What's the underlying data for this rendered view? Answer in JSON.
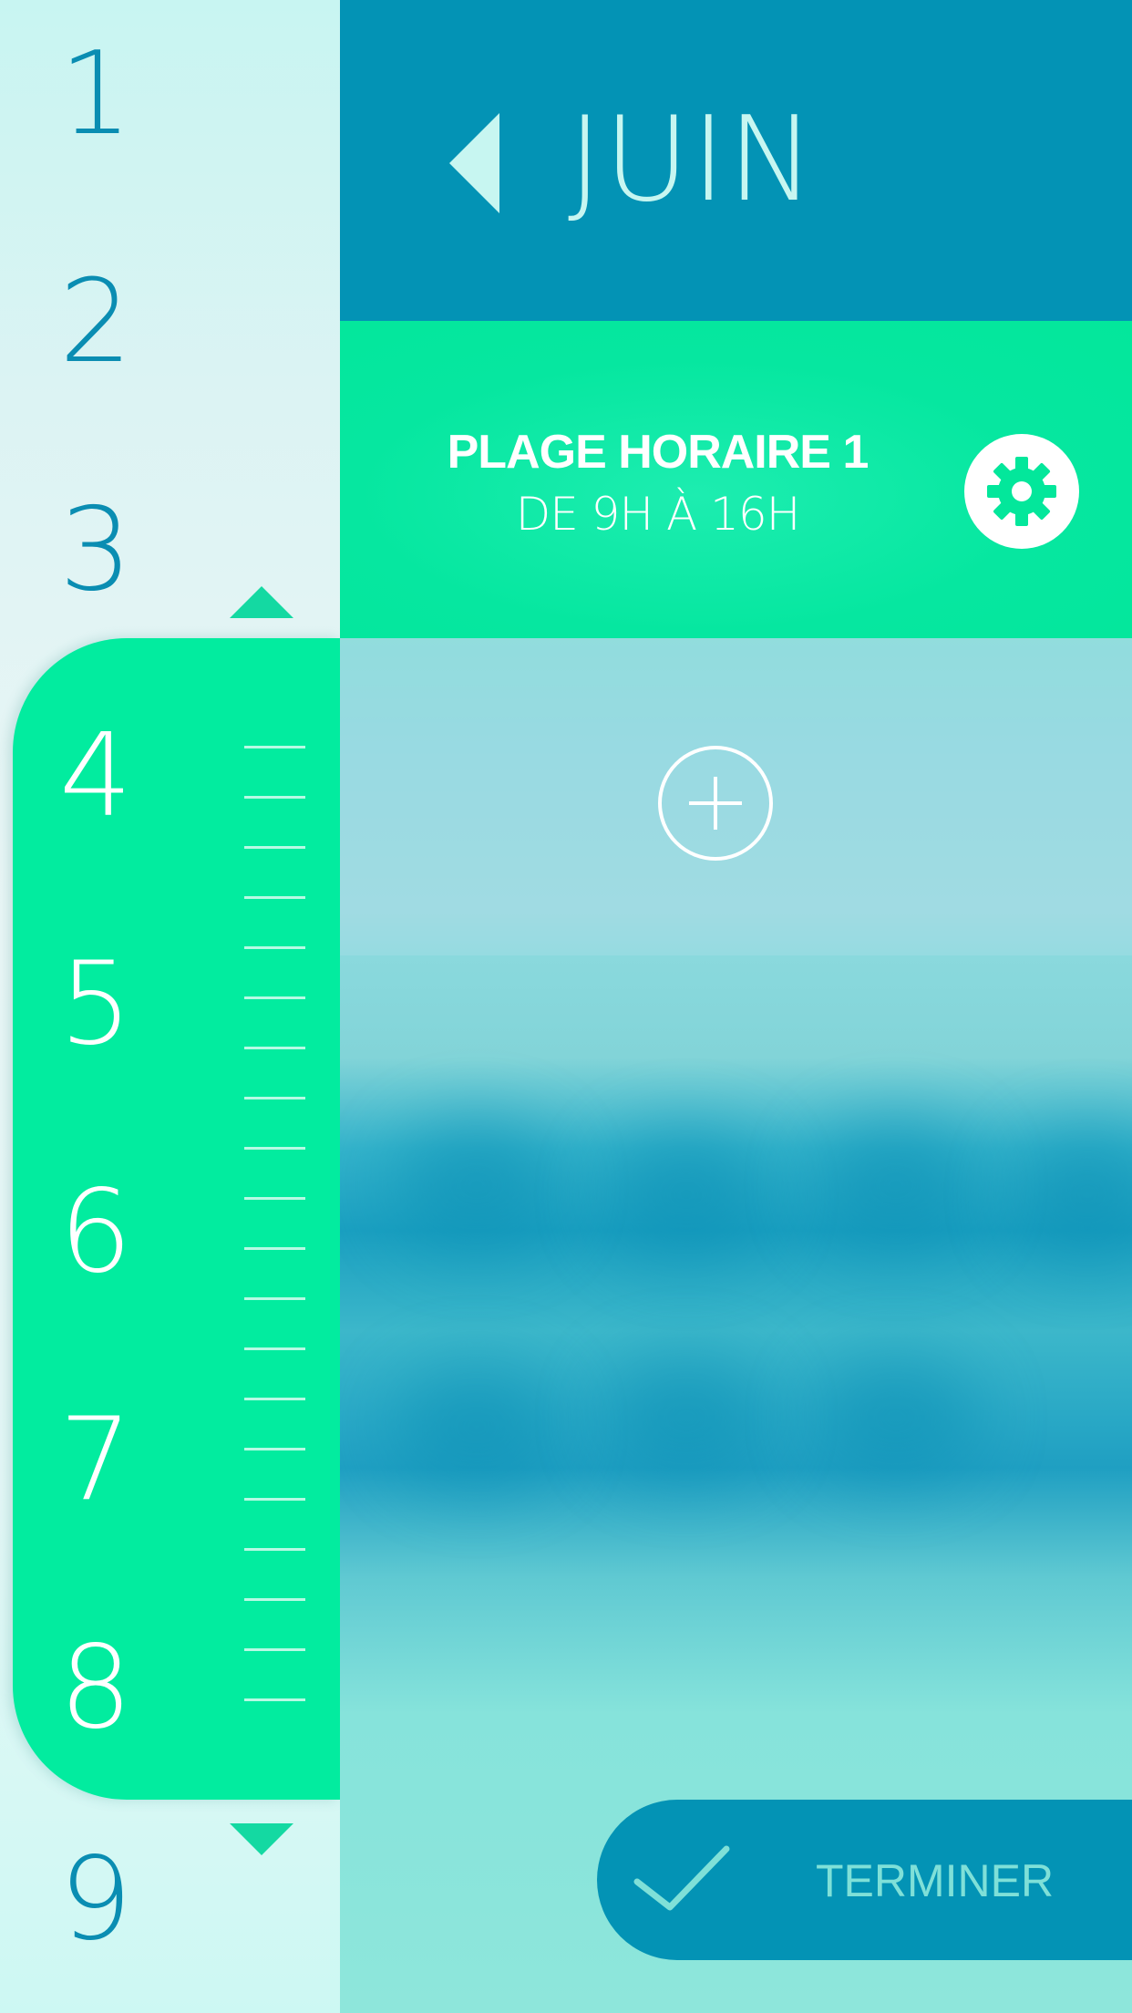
{
  "calendar": {
    "month": "JUIN",
    "days": [
      "1",
      "2",
      "3",
      "4",
      "5",
      "6",
      "7",
      "8",
      "9"
    ],
    "selected_range": [
      "4",
      "5",
      "6",
      "7",
      "8"
    ]
  },
  "time_slot": {
    "title": "PLAGE HORAIRE 1",
    "subtitle": "DE 9H À 16H"
  },
  "actions": {
    "done_label": "TERMINER"
  },
  "icons": {
    "prev_month": "triangle-left-icon",
    "settings": "gear-icon",
    "add": "plus-circle-icon",
    "done": "checkmark-icon",
    "scroll_up": "triangle-up-icon",
    "scroll_down": "triangle-down-icon"
  },
  "colors": {
    "header_blue": "#0393b5",
    "accent_green": "#02ec9f",
    "light_mint": "#c7f6f1",
    "day_text_blue": "#0a8db2"
  }
}
